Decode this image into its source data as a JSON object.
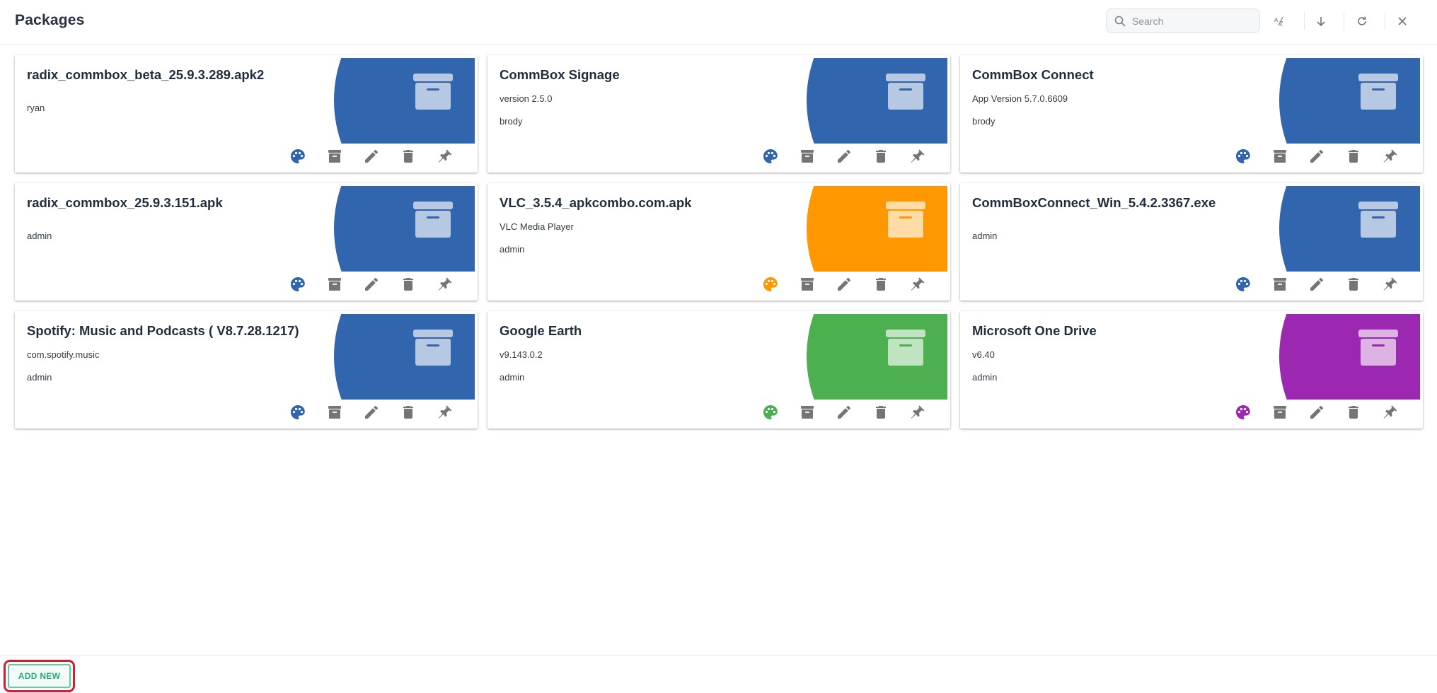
{
  "header": {
    "title": "Packages",
    "search_placeholder": "Search",
    "tools": [
      "sort-az-icon",
      "arrow-down-icon",
      "refresh-icon",
      "close-icon"
    ]
  },
  "colors": {
    "blue": "#3165ad",
    "orange": "#ff9800",
    "green": "#4caf50",
    "purple": "#9c27b0",
    "action_gray": "#757575",
    "accent_green": "#28a97c",
    "highlight_red": "#d0202f"
  },
  "cards": [
    {
      "title": "radix_commbox_beta_25.9.3.289.apk2",
      "subtitle": "",
      "owner": "ryan",
      "color": "#3165ad"
    },
    {
      "title": "CommBox Signage",
      "subtitle": "version 2.5.0",
      "owner": "brody",
      "color": "#3165ad"
    },
    {
      "title": "CommBox Connect",
      "subtitle": "App Version 5.7.0.6609",
      "owner": "brody",
      "color": "#3165ad"
    },
    {
      "title": "radix_commbox_25.9.3.151.apk",
      "subtitle": "",
      "owner": "admin",
      "color": "#3165ad"
    },
    {
      "title": "VLC_3.5.4_apkcombo.com.apk",
      "subtitle": "VLC Media Player",
      "owner": "admin",
      "color": "#ff9800"
    },
    {
      "title": "CommBoxConnect_Win_5.4.2.3367.exe",
      "subtitle": "",
      "owner": "admin",
      "color": "#3165ad"
    },
    {
      "title": "Spotify: Music and Podcasts ( V8.7.28.1217)",
      "subtitle": "com.spotify.music",
      "owner": "admin",
      "color": "#3165ad"
    },
    {
      "title": "Google Earth",
      "subtitle": "v9.143.0.2",
      "owner": "admin",
      "color": "#4caf50"
    },
    {
      "title": "Microsoft One Drive",
      "subtitle": "v6.40",
      "owner": "admin",
      "color": "#9c27b0"
    }
  ],
  "card_actions": [
    "palette-icon",
    "archive-icon",
    "edit-icon",
    "delete-icon",
    "pin-icon"
  ],
  "footer": {
    "add_new_label": "ADD NEW"
  }
}
